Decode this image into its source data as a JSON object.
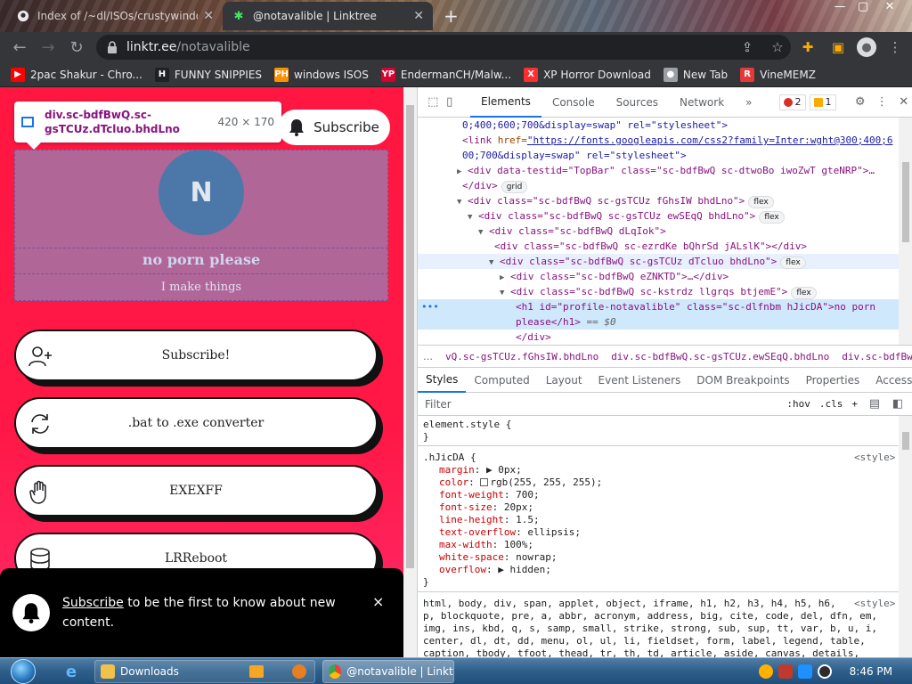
{
  "browser": {
    "tabs": [
      {
        "title": "Index of /~dl/ISOs/crustywindo",
        "active": false
      },
      {
        "title": "@notavalible | Linktree",
        "active": true
      }
    ],
    "new_tab": "+",
    "window_controls": {
      "minimize": "—",
      "maximize": "▢",
      "close": "✕"
    },
    "url": {
      "host": "linktr.ee",
      "path": "/notavalible"
    },
    "bookmarks": [
      {
        "label": "2pac Shakur - Chro...",
        "icon": "youtube-icon",
        "icon_text": "▶",
        "color": "#ff0000"
      },
      {
        "label": "FUNNY SNIPPIES",
        "icon": "h-icon",
        "icon_text": "H",
        "color": "#202124"
      },
      {
        "label": "windows ISOS",
        "icon": "ph-icon",
        "icon_text": "PH",
        "color": "#ff9000"
      },
      {
        "label": "EndermanCH/Malw...",
        "icon": "youtube-icon",
        "icon_text": "YP",
        "color": "#d7002f"
      },
      {
        "label": "XP Horror Download",
        "icon": "x-icon",
        "icon_text": "X",
        "color": "#ff2d2d"
      },
      {
        "label": "New Tab",
        "icon": "circle-icon",
        "icon_text": "●",
        "color": "#9aa0a6"
      },
      {
        "label": "VineMEMZ",
        "icon": "r-icon",
        "icon_text": "R",
        "color": "#e23a3a"
      }
    ]
  },
  "page": {
    "tooltip": {
      "selector": "div.sc-bdfBwQ.sc-gsTCUz.dTcluo.bhdLno",
      "dims": "420 × 170"
    },
    "subscribe_button": "Subscribe",
    "avatar_initial": "N",
    "profile_name": "no porn please",
    "profile_bio": "I make things",
    "links": [
      {
        "label": "Subscribe!",
        "icon": "add-user-icon"
      },
      {
        "label": ".bat to .exe converter",
        "icon": "refresh-icon"
      },
      {
        "label": "EXEXFF",
        "icon": "hand-icon"
      },
      {
        "label": "LRReboot",
        "icon": "database-icon"
      }
    ],
    "toast": {
      "link_text": "Subscribe",
      "message": " to be the first to know about new content.",
      "close": "×"
    }
  },
  "devtools": {
    "tabs": [
      "Elements",
      "Console",
      "Sources",
      "Network",
      "»"
    ],
    "active_tab": "Elements",
    "errors": "2",
    "warnings": "1",
    "dom": [
      {
        "indent": 50,
        "raw": "0;400;600;700&display=swap\" rel=\"stylesheet\">"
      },
      {
        "indent": 50,
        "tag_open": "<link ",
        "attr": "href=",
        "link": "\"https://fonts.googleapis.com/css2?family=Inter:wght@300;400;6"
      },
      {
        "indent": 50,
        "raw": "00;700&display=swap\" rel=\"stylesheet\">"
      },
      {
        "indent": 44,
        "tri": "▶",
        "tag": "<div data-testid=\"TopBar\" class=\"sc-bdfBwQ sc-dtwoBo iwoZwT gteNRP\">…",
        "pill": ""
      },
      {
        "indent": 50,
        "tag": "</div>",
        "pill": "grid"
      },
      {
        "indent": 44,
        "tri": "▼",
        "tag": "<div class=\"sc-bdfBwQ sc-gsTCUz fGhsIW bhdLno\">",
        "pill": "flex"
      },
      {
        "indent": 56,
        "tri": "▼",
        "tag": "<div class=\"sc-bdfBwQ sc-gsTCUz ewSEqQ bhdLno\">",
        "pill": "flex"
      },
      {
        "indent": 68,
        "tri": "▼",
        "tag": "<div class=\"sc-bdfBwQ dLqIok\">",
        "pill": ""
      },
      {
        "indent": 86,
        "tag": "<div class=\"sc-bdfBwQ sc-ezrdKe bQhrSd jALslK\"></div>",
        "pill": ""
      },
      {
        "indent": 80,
        "tri": "▼",
        "tag": "<div class=\"sc-bdfBwQ sc-gsTCUz dTcluo bhdLno\">",
        "pill": "flex"
      },
      {
        "indent": 92,
        "tri": "▶",
        "tag": "<div class=\"sc-bdfBwQ eZNKTD\">…</div>",
        "pill": ""
      },
      {
        "indent": 92,
        "tri": "▼",
        "tag": "<div class=\"sc-bdfBwQ sc-kstrdz llgrqs btjemE\">",
        "pill": "flex"
      },
      {
        "indent": 110,
        "tag": "<h1 id=\"profile-notavalible\" class=\"sc-dlfnbm hJicDA\">no porn",
        "pill": ""
      },
      {
        "indent": 110,
        "tag": "please</h1>",
        "eq": " == $0",
        "pill": ""
      },
      {
        "indent": 110,
        "tag": "</div>",
        "pill": ""
      }
    ],
    "breadcrumbs": [
      "vQ.sc-gsTCUz.fGhsIW.bhdLno",
      "div.sc-bdfBwQ.sc-gsTCUz.ewSEqQ.bhdLno",
      "div.sc-bdfBwQ.dLq"
    ],
    "sub_tabs": [
      "Styles",
      "Computed",
      "Layout",
      "Event Listeners",
      "DOM Breakpoints",
      "Properties",
      "Accessibility"
    ],
    "filter_placeholder": "Filter",
    "filter_buttons": [
      ":hov",
      ".cls",
      "+"
    ],
    "styles": {
      "element_style": "element.style {",
      "rule_selector": ".hJicDA {",
      "rule_source": "<style>",
      "props": [
        {
          "name": "margin",
          "value": "▶ 0px;"
        },
        {
          "name": "color",
          "value": "rgb(255, 255, 255);"
        },
        {
          "name": "font-weight",
          "value": "700;"
        },
        {
          "name": "font-size",
          "value": "20px;"
        },
        {
          "name": "line-height",
          "value": "1.5;"
        },
        {
          "name": "text-overflow",
          "value": "ellipsis;"
        },
        {
          "name": "max-width",
          "value": "100%;"
        },
        {
          "name": "white-space",
          "value": "nowrap;"
        },
        {
          "name": "overflow",
          "value": "▶ hidden;"
        }
      ],
      "close_brace": "}",
      "ua_lines": [
        "html, body, div, span, applet, object, iframe, h1, h2, h3, h4, h5, h6,",
        "p, blockquote, pre, a, abbr, acronym, address, big, cite, code, del, dfn, em,",
        "img, ins, kbd, q, s, samp, small, strike, strong, sub, sup, tt, var, b, u, i,",
        "center, dl, dt, dd, menu, ol, ul, li, fieldset, form, label, legend, table,",
        "caption, tbody, tfoot, thead, tr, th, td, article, aside, canvas, details,"
      ],
      "ua_source": "<style>"
    }
  },
  "taskbar": {
    "windows": [
      {
        "label": "Downloads",
        "active": false
      },
      {
        "label": "@notavalible | Linktr...",
        "active": true
      }
    ],
    "clock": "8:46 PM"
  }
}
